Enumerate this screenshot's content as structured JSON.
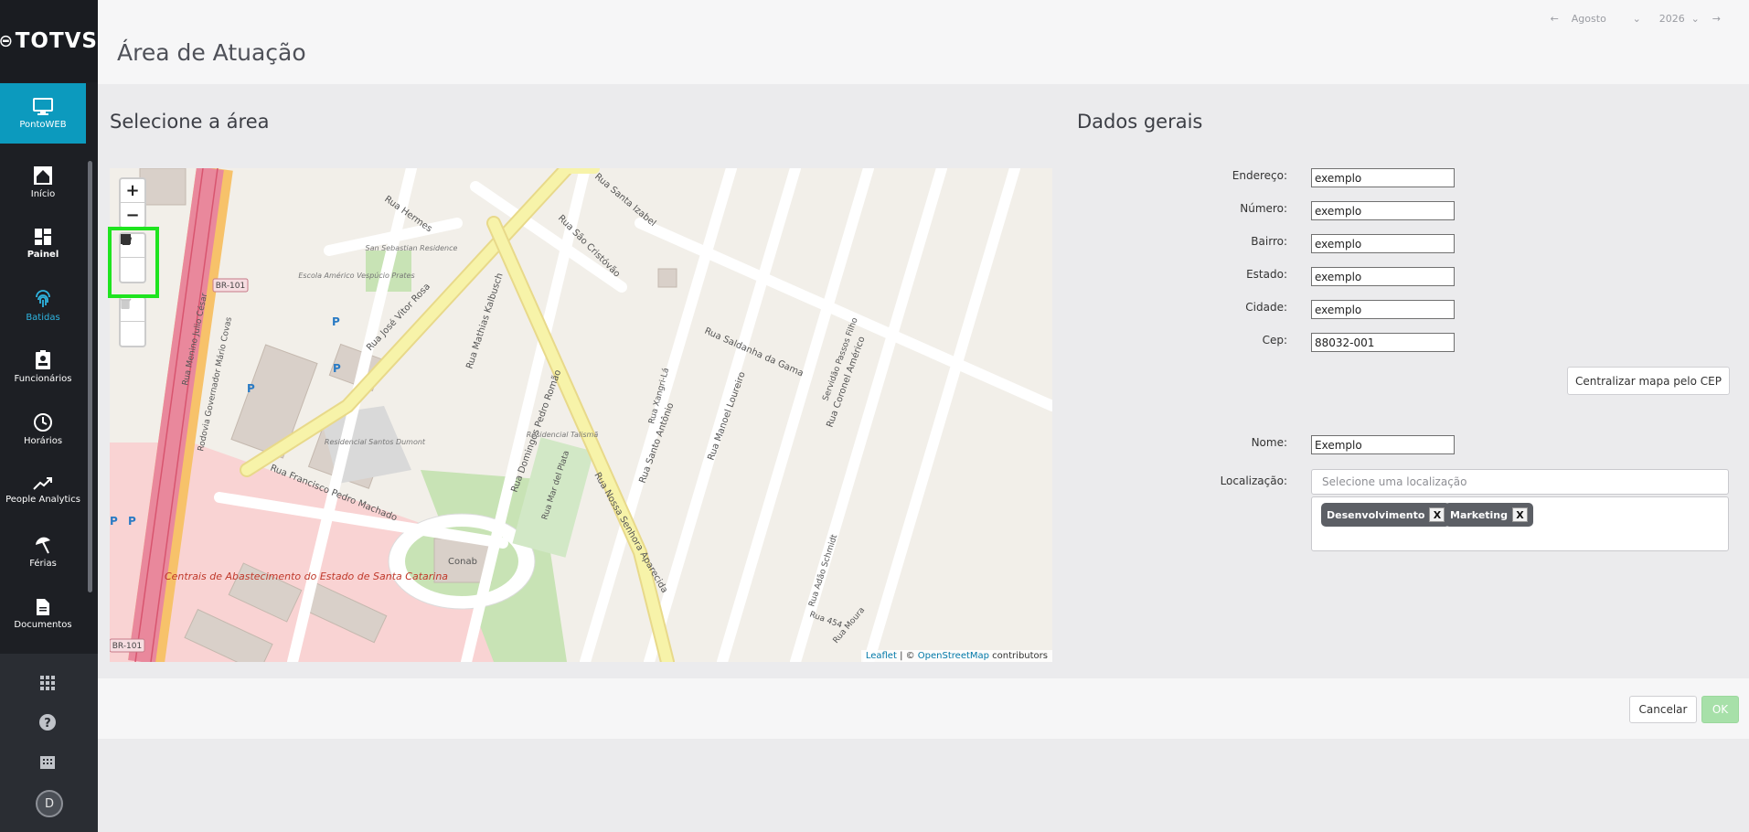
{
  "app": {
    "brand": "TOTVS"
  },
  "sidebar": {
    "items": [
      {
        "label": "PontoWEB",
        "icon": "monitor-icon"
      },
      {
        "label": "Início",
        "icon": "home-icon"
      },
      {
        "label": "Painel",
        "icon": "dashboard-icon"
      },
      {
        "label": "Batidas",
        "icon": "fingerprint-icon"
      },
      {
        "label": "Funcionários",
        "icon": "id-badge-icon"
      },
      {
        "label": "Horários",
        "icon": "clock-icon"
      },
      {
        "label": "People Analytics",
        "icon": "trend-icon"
      },
      {
        "label": "Férias",
        "icon": "beach-umbrella-icon"
      },
      {
        "label": "Documentos",
        "icon": "document-icon"
      }
    ],
    "bottom_icons": [
      "apps-grid-icon",
      "help-icon",
      "building-icon"
    ],
    "avatar_initial": "D"
  },
  "header": {
    "title": "Área de Atuação",
    "month": "Agosto",
    "year": "2026"
  },
  "map_section": {
    "title": "Selecione a área",
    "zoom_in": "+",
    "zoom_out": "−",
    "attribution_leaflet": "Leaflet",
    "attribution_sep": " | © ",
    "attribution_osm": "OpenStreetMap",
    "attribution_tail": " contributors",
    "labels": {
      "br101_a": "BR-101",
      "br101_b": "BR-101",
      "conab": "Conab",
      "residencial_santos": "Residencial Santos Dumont",
      "residencial_talisma": "Residencial Talismã",
      "escola": "Escola Américo Vespúcio Prates",
      "san_sebastian": "San Sebastian Residence",
      "centrais": "Centrais de Abastecimento do Estado de Santa Catarina",
      "r_jose_vitor_rosa": "Rua José Vitor Rosa",
      "r_francisco": "Rua Francisco Pedro Machado",
      "r_saldanha": "Rua Saldanha da Gama",
      "r_santo_antonio": "Rua Santo Antônio",
      "r_manoel_loureiro": "Rua Manoel Loureiro",
      "r_coronel_americo": "Rua Coronel Américo",
      "r_servidao": "Servidão Passos Filho",
      "r_nossa_senhora": "Rua Nossa Senhora Aparecida",
      "r_mathias": "Rua Mathias Kalbusch",
      "r_domingos": "Rua Domingos Pedro Romão",
      "r_mar_del_plata": "Rua Mar del Plata",
      "r_sao_cristovao": "Rua São Cristóvão",
      "r_hermes": "Rua Hermes",
      "r_santa_izabel": "Rua Santa Izabel",
      "r_adao": "Rua Adão Schmidt",
      "r_moura": "Rua Moura",
      "r_454": "Rua 454",
      "r_menino_julio": "Rua Menino Julio César",
      "r_rodovia": "Rodovia Governador Mário Covas",
      "r_xangri": "Rua Xangri-Lá"
    }
  },
  "form": {
    "title": "Dados gerais",
    "fields": [
      {
        "label": "Endereço:",
        "value": "exemplo"
      },
      {
        "label": "Número:",
        "value": "exemplo"
      },
      {
        "label": "Bairro:",
        "value": "exemplo"
      },
      {
        "label": "Estado:",
        "value": "exemplo"
      },
      {
        "label": "Cidade:",
        "value": "exemplo"
      },
      {
        "label": "Cep:",
        "value": "88032-001"
      }
    ],
    "center_button": "Centralizar mapa pelo CEP",
    "name_label": "Nome:",
    "name_value": "Exemplo",
    "location_label": "Localização:",
    "location_placeholder": "Selecione uma localização",
    "tags": [
      {
        "label": "Desenvolvimento",
        "remove": "X"
      },
      {
        "label": "Marketing",
        "remove": "X"
      }
    ]
  },
  "footer": {
    "cancel": "Cancelar",
    "ok": "OK"
  },
  "colors": {
    "accent": "#0c9abe",
    "ok_button": "#a7e0a9",
    "draw_highlight": "#1fe41f"
  }
}
